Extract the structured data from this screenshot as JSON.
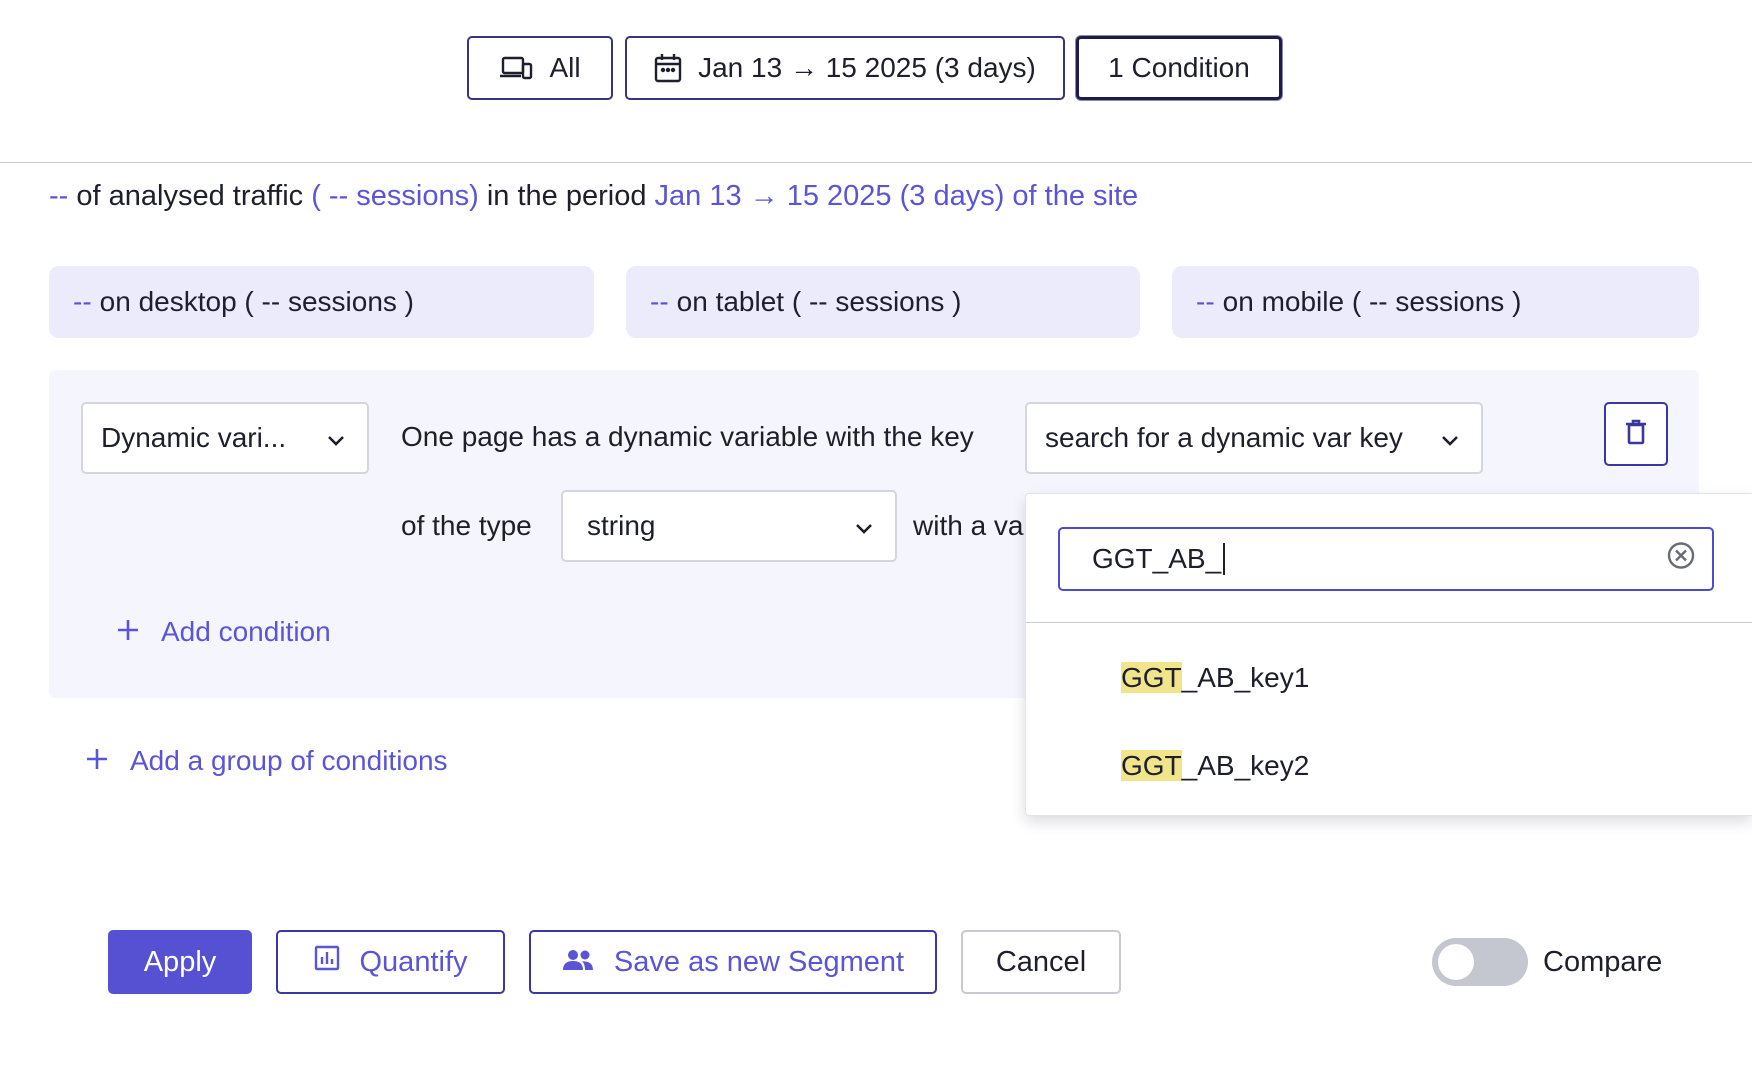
{
  "topbar": {
    "device_label": "All",
    "date_label": "Jan 13 → 15 2025 (3 days)",
    "condition_label": "1 Condition"
  },
  "summary": {
    "traffic_value": "--",
    "text1": "of analysed traffic",
    "sessions_text": "( -- sessions)",
    "text2": "in the period",
    "period_text": "Jan 13 → 15 2025 (3 days) of the site"
  },
  "devices": [
    {
      "value": "--",
      "text": "on desktop ( -- sessions )"
    },
    {
      "value": "--",
      "text": "on tablet ( -- sessions )"
    },
    {
      "value": "--",
      "text": "on mobile ( -- sessions )"
    }
  ],
  "condition": {
    "type_select": "Dynamic vari...",
    "key_sentence": "One page has a dynamic variable with the key",
    "key_select": "search for a dynamic var key",
    "type_label": "of the type",
    "value_type_select": "string",
    "value_label_visible": "with a va",
    "add_condition": "Add condition"
  },
  "add_group": "Add a group of conditions",
  "dropdown": {
    "search_value": "GGT_AB_",
    "results": [
      {
        "match": "GGT",
        "rest": "_AB_key1"
      },
      {
        "match": "GGT",
        "rest": "_AB_key2"
      }
    ]
  },
  "actions": {
    "apply": "Apply",
    "quantify": "Quantify",
    "save_segment": "Save as new Segment",
    "cancel": "Cancel",
    "compare": "Compare",
    "compare_enabled": false
  },
  "colors": {
    "accent": "#5650d2",
    "link": "#5a55d6",
    "device_card_bg": "#ebebfb",
    "highlight": "#f0e58a"
  }
}
